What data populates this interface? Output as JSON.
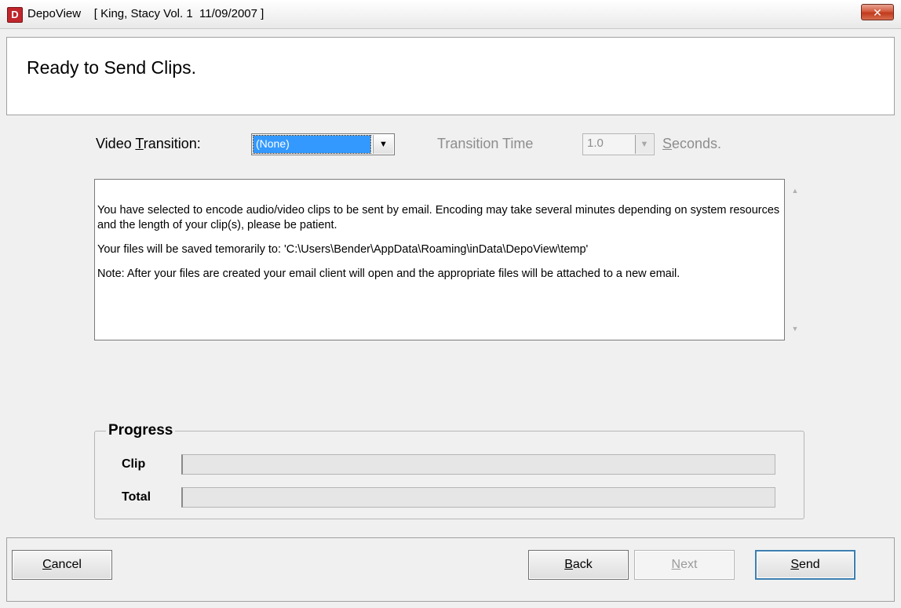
{
  "window": {
    "app_name": "DepoView",
    "case_info": "[ King, Stacy Vol. 1  11/09/2007 ]",
    "close_glyph": "✕"
  },
  "header": {
    "title": "Ready to Send Clips."
  },
  "transition": {
    "label_pre": "Video ",
    "label_key": "T",
    "label_post": "ransition:",
    "selected": "(None)",
    "time_label": "Transition Time",
    "time_value": "1.0",
    "seconds_key": "S",
    "seconds_rest": "econds."
  },
  "message": {
    "paragraphs": [
      "You have selected to encode audio/video clips to be sent by email. Encoding may take several minutes depending on system resources and the length of your clip(s), please be patient.",
      "Your files will be saved temorarily to: 'C:\\Users\\Bender\\AppData\\Roaming\\inData\\DepoView\\temp'",
      "Note: After your files are created your email client will open and the appropriate files will be attached to a new email."
    ]
  },
  "progress": {
    "title": "Progress",
    "clip_label": "Clip",
    "total_label": "Total",
    "clip_fraction": 0,
    "total_fraction": 0
  },
  "buttons": {
    "cancel_key": "C",
    "cancel_rest": "ancel",
    "back_key": "B",
    "back_rest": "ack",
    "next_key": "N",
    "next_rest": "ext",
    "send_key": "S",
    "send_rest": "end"
  },
  "colors": {
    "selection": "#3399ff",
    "close": "#c2391c",
    "app_icon": "#c0262c"
  },
  "icons": [
    "app-icon",
    "close-icon",
    "dropdown-arrow-icon",
    "scroll-up-icon",
    "scroll-down-icon"
  ]
}
